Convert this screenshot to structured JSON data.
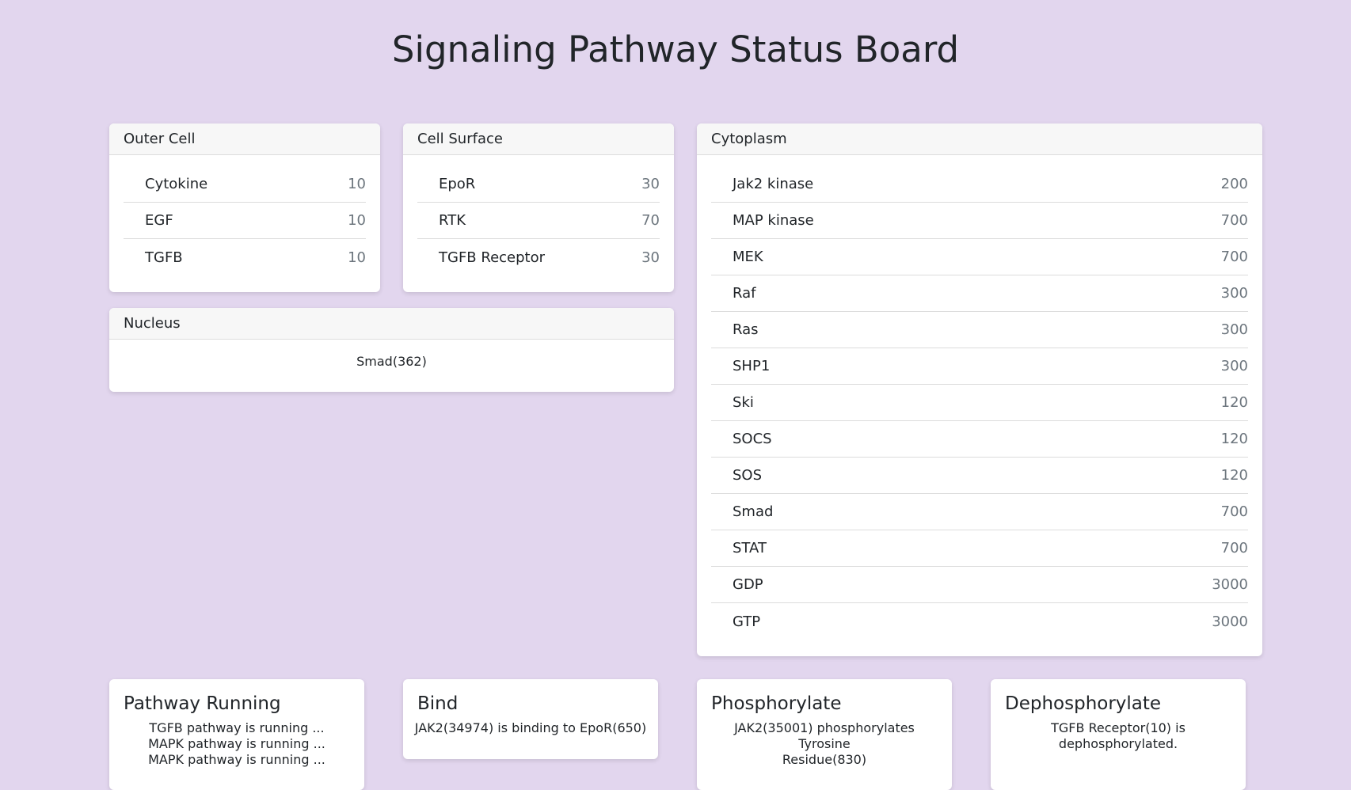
{
  "title": "Signaling Pathway Status Board",
  "outer_cell": {
    "title": "Outer Cell",
    "items": [
      {
        "name": "Cytokine",
        "value": "10"
      },
      {
        "name": "EGF",
        "value": "10"
      },
      {
        "name": "TGFB",
        "value": "10"
      }
    ]
  },
  "cell_surface": {
    "title": "Cell Surface",
    "items": [
      {
        "name": "EpoR",
        "value": "30"
      },
      {
        "name": "RTK",
        "value": "70"
      },
      {
        "name": "TGFB Receptor",
        "value": "30"
      }
    ]
  },
  "nucleus": {
    "title": "Nucleus",
    "content": "Smad(362)"
  },
  "cytoplasm": {
    "title": "Cytoplasm",
    "items": [
      {
        "name": "Jak2 kinase",
        "value": "200"
      },
      {
        "name": "MAP kinase",
        "value": "700"
      },
      {
        "name": "MEK",
        "value": "700"
      },
      {
        "name": "Raf",
        "value": "300"
      },
      {
        "name": "Ras",
        "value": "300"
      },
      {
        "name": "SHP1",
        "value": "300"
      },
      {
        "name": "Ski",
        "value": "120"
      },
      {
        "name": "SOCS",
        "value": "120"
      },
      {
        "name": "SOS",
        "value": "120"
      },
      {
        "name": "Smad",
        "value": "700"
      },
      {
        "name": "STAT",
        "value": "700"
      },
      {
        "name": "GDP",
        "value": "3000"
      },
      {
        "name": "GTP",
        "value": "3000"
      }
    ]
  },
  "pathway_running": {
    "title": "Pathway Running",
    "lines": [
      "TGFB pathway is running ...",
      "MAPK pathway is running ...",
      "MAPK pathway is running ..."
    ]
  },
  "bind": {
    "title": "Bind",
    "lines": [
      "JAK2(34974) is binding to EpoR(650)"
    ]
  },
  "phosphorylate": {
    "title": "Phosphorylate",
    "lines": [
      "JAK2(35001) phosphorylates Tyrosine",
      "Residue(830)"
    ]
  },
  "dephosphorylate": {
    "title": "Dephosphorylate",
    "lines": [
      "TGFB Receptor(10) is",
      "dephosphorylated."
    ]
  }
}
